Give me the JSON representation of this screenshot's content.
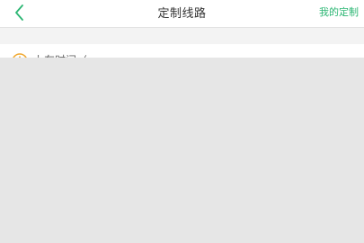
{
  "nav": {
    "title": "定制线路",
    "right_link": "我的定制",
    "accent_color": "#2bb673",
    "back_icon": "chevron-left-icon"
  },
  "form": {
    "boarding_time_label": "上车时间（出发）",
    "clock_icon": "clock-icon",
    "clock_color": "#f0a830"
  }
}
